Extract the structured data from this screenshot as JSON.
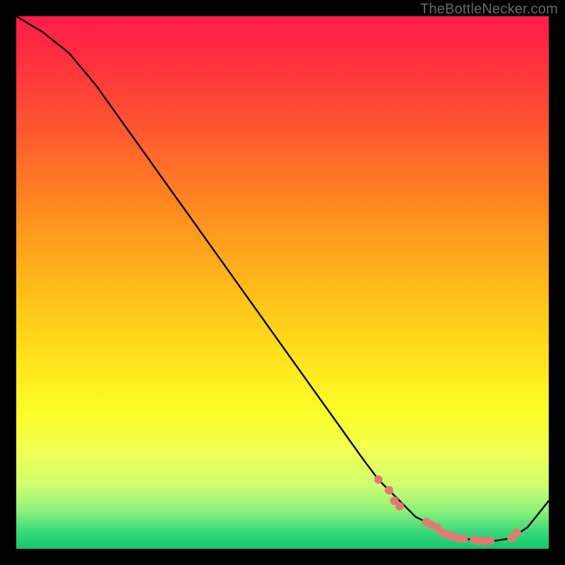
{
  "watermark": "TheBottleNecker.com",
  "chart_data": {
    "type": "line",
    "title": "",
    "xlabel": "",
    "ylabel": "",
    "xlim": [
      0,
      100
    ],
    "ylim": [
      0,
      100
    ],
    "series": [
      {
        "name": "curve",
        "x": [
          0,
          5,
          10,
          15,
          20,
          25,
          30,
          35,
          40,
          45,
          50,
          55,
          60,
          65,
          68,
          70,
          73,
          75,
          78,
          80,
          82,
          85,
          88,
          90,
          93,
          96,
          100
        ],
        "y": [
          100,
          97,
          93,
          87,
          80,
          73,
          66,
          59,
          52,
          45,
          38,
          31,
          24,
          17,
          13,
          11,
          8,
          6,
          4.5,
          3,
          2.3,
          1.8,
          1.5,
          1.5,
          2,
          4,
          9
        ]
      }
    ],
    "highlight_points": {
      "comment": "salmon dots along low portion of curve",
      "color": "#e37a72",
      "x": [
        68,
        70,
        71,
        72,
        77,
        78,
        79,
        80,
        81,
        82,
        83,
        84,
        86,
        87,
        88,
        89,
        93,
        94
      ],
      "y": [
        13,
        11,
        9,
        8,
        5,
        4.5,
        4,
        3,
        2.7,
        2.3,
        2.0,
        1.9,
        1.7,
        1.5,
        1.5,
        1.5,
        2.0,
        3.0
      ]
    },
    "background_gradient": {
      "orientation": "vertical",
      "stops": [
        {
          "pos": 0.0,
          "color": "#ff1c4a"
        },
        {
          "pos": 0.5,
          "color": "#ffe11a"
        },
        {
          "pos": 0.82,
          "color": "#f0ff55"
        },
        {
          "pos": 1.0,
          "color": "#14c86a"
        }
      ]
    }
  }
}
